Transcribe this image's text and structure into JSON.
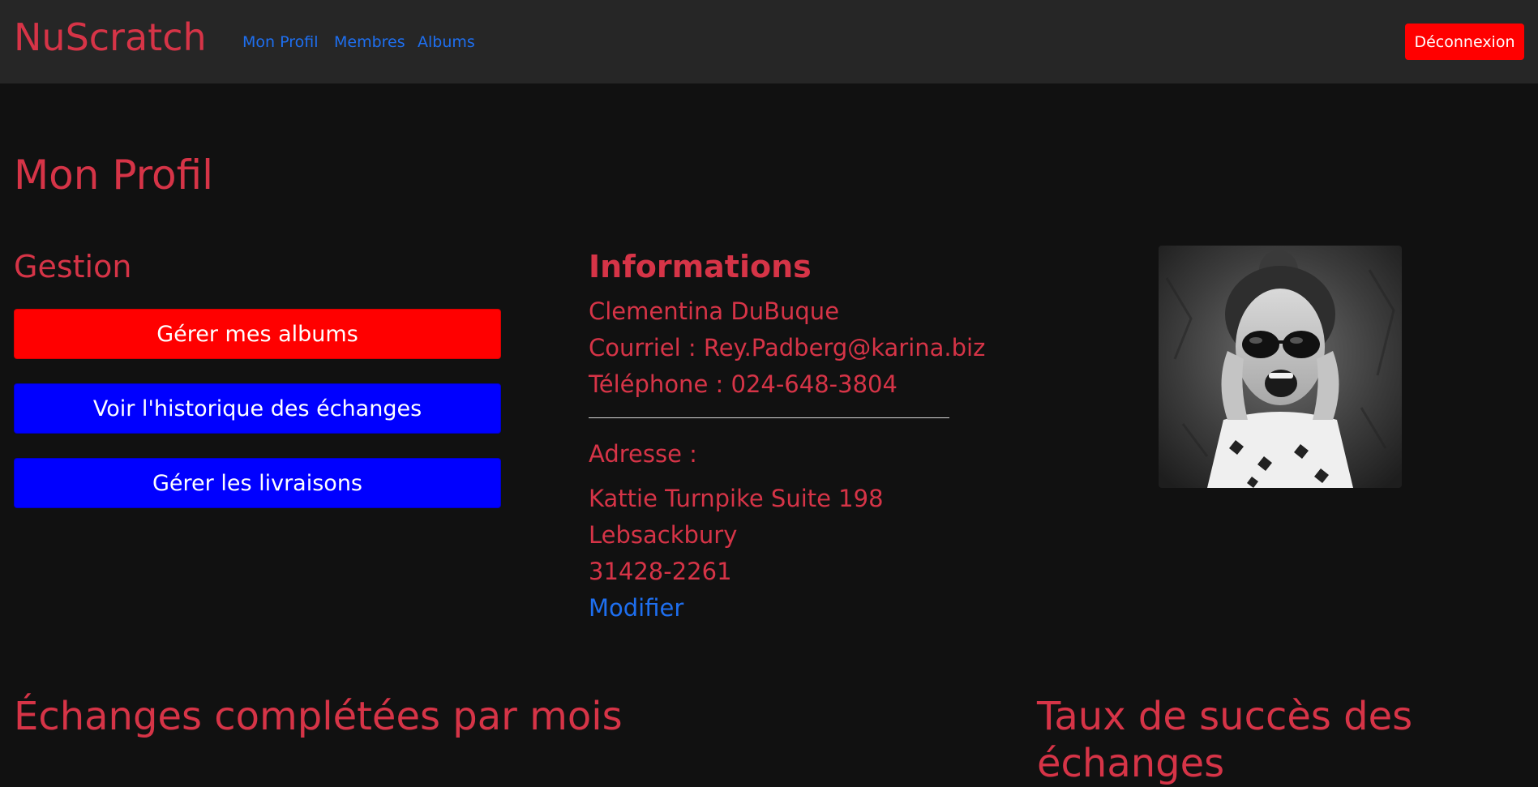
{
  "navbar": {
    "brand": "NuScratch",
    "links": [
      "Mon Profil",
      "Membres",
      "Albums"
    ],
    "logout_label": "Déconnexion"
  },
  "page": {
    "title": "Mon Profil"
  },
  "gestion": {
    "heading": "Gestion",
    "buttons": [
      "Gérer mes albums",
      "Voir l'historique des échanges",
      "Gérer les livraisons"
    ]
  },
  "informations": {
    "heading": "Informations",
    "name": "Clementina DuBuque",
    "email_line": "Courriel : Rey.Padberg@karina.biz",
    "phone_line": "Téléphone : 024-648-3804",
    "address_label": "Adresse :",
    "address_street": "Kattie Turnpike Suite 198",
    "address_city": "Lebsackbury",
    "address_postal": "31428-2261",
    "modify_label": "Modifier"
  },
  "sections": {
    "exchanges_per_month": "Échanges complétées par mois",
    "success_rate": "Taux de succès des échanges"
  },
  "colors": {
    "accent": "#d63447",
    "link": "#1e6ff0",
    "danger_button": "#ff0000",
    "primary_button": "#0000ff",
    "navbar_bg": "#262626",
    "page_bg": "#111111"
  }
}
